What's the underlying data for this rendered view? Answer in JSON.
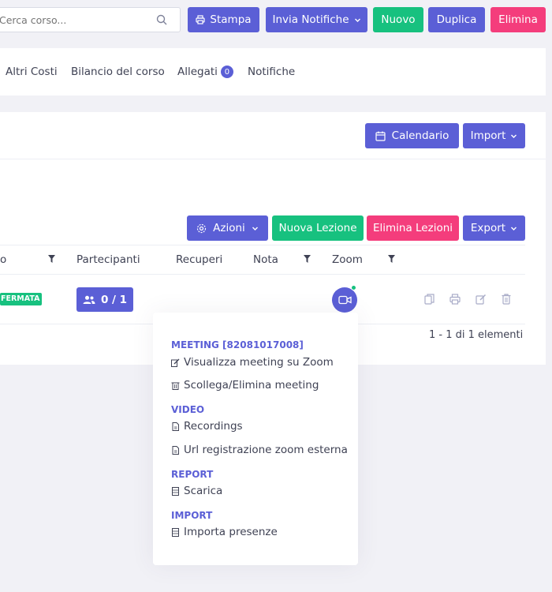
{
  "search": {
    "placeholder": "Cerca corso..."
  },
  "toolbar": {
    "print": "Stampa",
    "notify": "Invia Notifiche",
    "new": "Nuovo",
    "duplicate": "Duplica",
    "delete": "Elimina"
  },
  "tabs": [
    {
      "label": "Altri Costi"
    },
    {
      "label": "Bilancio del corso"
    },
    {
      "label": "Allegati",
      "badge": "0"
    },
    {
      "label": "Notifiche"
    }
  ],
  "section": {
    "calendar": "Calendario",
    "import": "Import"
  },
  "lessons_toolbar": {
    "actions": "Azioni",
    "new_lesson": "Nuova Lezione",
    "delete_lessons": "Elimina Lezioni",
    "export": "Export"
  },
  "table": {
    "columns": [
      "o",
      "Partecipanti",
      "Recuperi",
      "Nota",
      "Zoom"
    ],
    "row": {
      "status": "FERMATA",
      "participants": "0 / 1"
    },
    "pagination": "1 - 1 di 1 elementi"
  },
  "zoom_menu": {
    "meeting_header": "MEETING [82081017008]",
    "view_meeting": "Visualizza meeting su Zoom",
    "unlink_meeting": "Scollega/Elimina meeting",
    "video_header": "VIDEO",
    "recordings": "Recordings",
    "external_url": "Url registrazione zoom esterna",
    "report_header": "REPORT",
    "download": "Scarica",
    "import_header": "IMPORT",
    "import_attendance": "Importa presenze"
  },
  "colors": {
    "indigo": "#5b5fd6",
    "green": "#17c17f",
    "pink": "#f43d7c"
  }
}
